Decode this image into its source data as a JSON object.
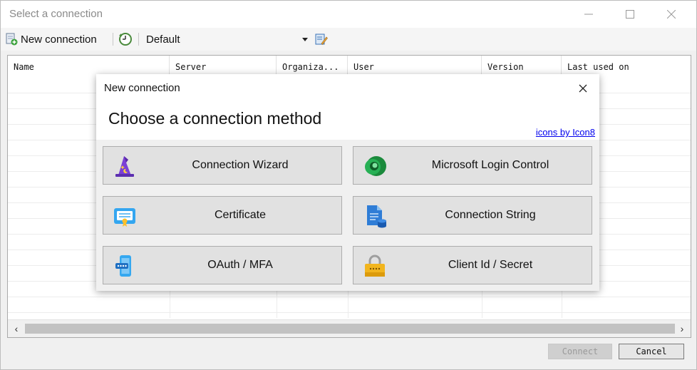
{
  "window": {
    "title": "Select a connection"
  },
  "toolbar": {
    "new_connection_label": "New connection",
    "profile_value": "Default"
  },
  "grid": {
    "columns": [
      "Name",
      "Server",
      "Organiza...",
      "User",
      "Version",
      "Last used on"
    ]
  },
  "footer": {
    "connect_label": "Connect",
    "cancel_label": "Cancel"
  },
  "dialog": {
    "title": "New connection",
    "heading": "Choose a connection method",
    "credit_link": "icons by Icon8",
    "options": [
      {
        "label": "Connection Wizard",
        "icon": "wizard-icon"
      },
      {
        "label": "Microsoft Login Control",
        "icon": "dataverse-icon"
      },
      {
        "label": "Certificate",
        "icon": "certificate-icon"
      },
      {
        "label": "Connection String",
        "icon": "connection-string-icon"
      },
      {
        "label": "OAuth / MFA",
        "icon": "phone-icon"
      },
      {
        "label": "Client Id / Secret",
        "icon": "lock-icon"
      }
    ]
  }
}
